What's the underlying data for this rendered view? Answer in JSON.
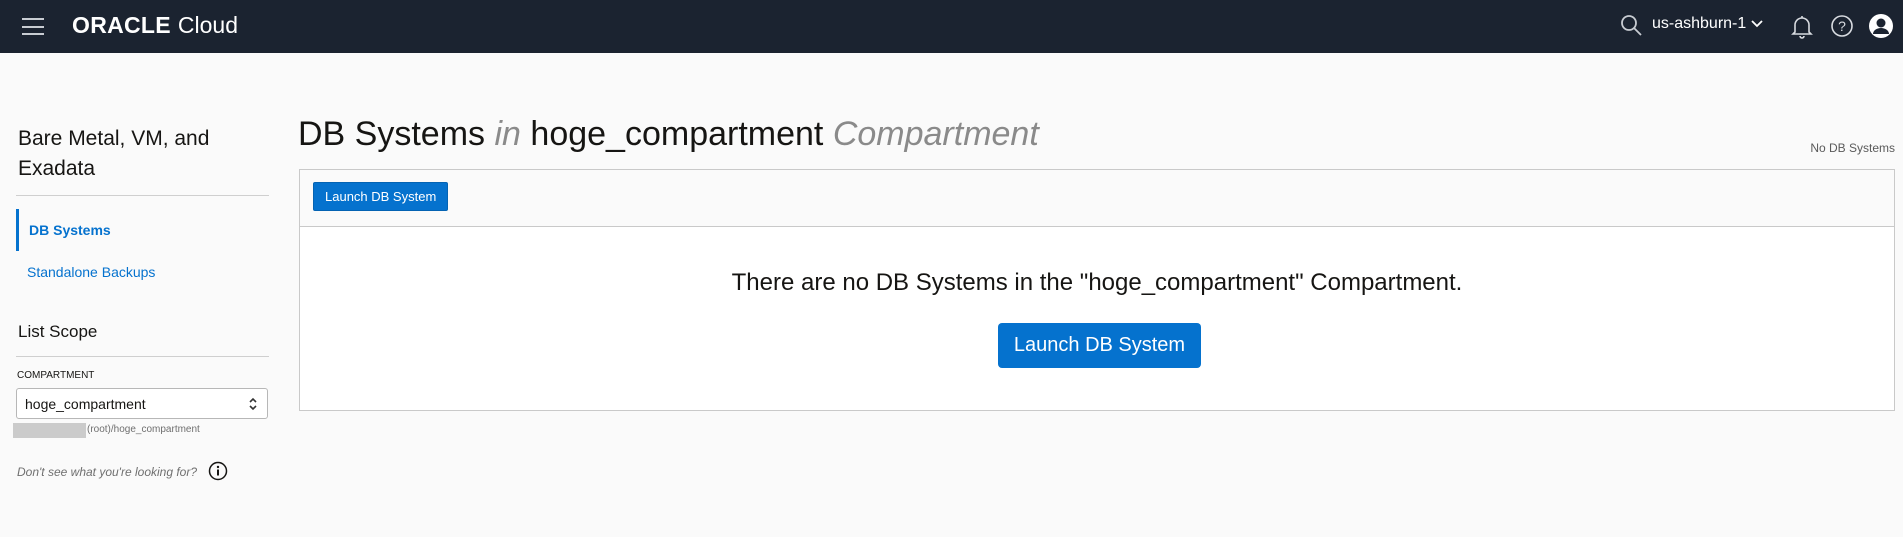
{
  "header": {
    "logo_text": "ORACLE",
    "logo_product": "Cloud",
    "region": "us-ashburn-1"
  },
  "icons": {
    "menu": "hamburger-icon",
    "search": "search-icon",
    "region_dropdown": "chevron-down-icon",
    "notifications": "bell-icon",
    "help": "help-icon",
    "profile": "user-icon",
    "info": "info-icon"
  },
  "sidebar": {
    "title": "Bare Metal, VM, and Exadata",
    "items": [
      {
        "label": "DB Systems",
        "active": true
      },
      {
        "label": "Standalone Backups",
        "active": false
      }
    ],
    "scope_title": "List Scope",
    "compartment_label": "COMPARTMENT",
    "compartment_value": "hoge_compartment",
    "compartment_path": "(root)/hoge_compartment",
    "help_text": "Don't see what you're looking for?"
  },
  "main": {
    "title_prefix": "DB Systems",
    "title_in": "in",
    "title_compartment": "hoge_compartment",
    "title_suffix": "Compartment",
    "count_text": "No DB Systems",
    "toolbar_button": "Launch DB System",
    "empty_message": "There are no DB Systems in the \"hoge_compartment\" Compartment.",
    "empty_button": "Launch DB System"
  },
  "colors": {
    "header_bg": "#1b2330",
    "accent": "#0572ce",
    "page_bg": "#fafafa"
  }
}
